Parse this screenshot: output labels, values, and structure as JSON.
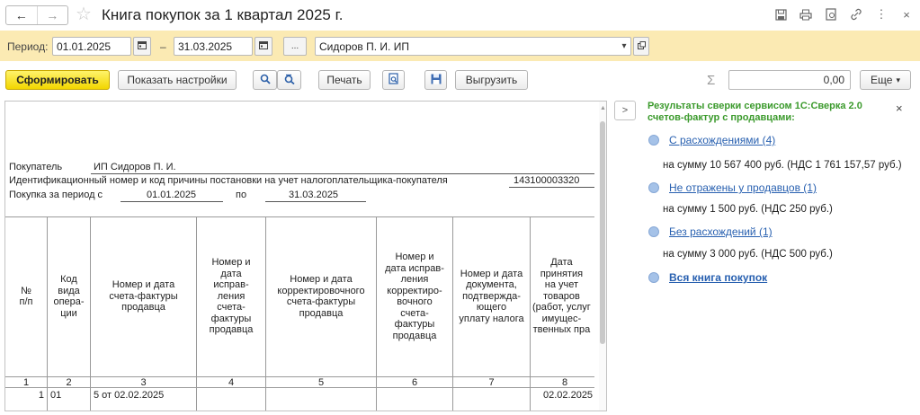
{
  "window": {
    "title": "Книга покупок за 1 квартал 2025 г.",
    "back_icon": "arrow-left",
    "forward_icon": "arrow-right",
    "favorite_icon": "star",
    "more_icon": "⋮",
    "close_icon": "×"
  },
  "period": {
    "label": "Период:",
    "from": "01.01.2025",
    "dash": "–",
    "to": "31.03.2025",
    "ellipsis": "...",
    "organization": "Сидоров П. И. ИП"
  },
  "toolbar": {
    "generate": "Сформировать",
    "show_settings": "Показать настройки",
    "print": "Печать",
    "export": "Выгрузить",
    "sigma": "Σ",
    "sum_value": "0,00",
    "more": "Еще"
  },
  "report": {
    "buyer_label": "Покупатель",
    "buyer_value": "ИП Сидоров П. И.",
    "inn_label": "Идентификационный номер и код причины постановки на учет налогоплательщика-покупателя",
    "inn_value": "143100003320",
    "period_label": "Покупка за период с",
    "period_from": "01.01.2025",
    "period_to_label": "по",
    "period_to": "31.03.2025",
    "columns": [
      {
        "num": "1",
        "header": "№\nп/п"
      },
      {
        "num": "2",
        "header": "Код\nвида\nопера-\nции"
      },
      {
        "num": "3",
        "header": "Номер и дата\nсчета-фактуры\nпродавца"
      },
      {
        "num": "4",
        "header": "Номер и\nдата\nисправ-\nления\nсчета-\nфактуры\nпродавца"
      },
      {
        "num": "5",
        "header": "Номер и дата\nкорректировочного\nсчета-фактуры\nпродавца"
      },
      {
        "num": "6",
        "header": "Номер и\nдата исправ-\nления\nкорректиро-\nвочного\nсчета-\nфактуры\nпродавца"
      },
      {
        "num": "7",
        "header": "Номер и дата\nдокумента,\nподтвержда-\nющего\nуплату налога"
      },
      {
        "num": "8",
        "header": "Дата\nпринятия\nна учет\nтоваров\n(работ, услуг\nимущес-\nтвенных пра"
      }
    ],
    "row1": {
      "n": "1",
      "code": "01",
      "invoice": "5 от 02.02.2025",
      "accept_date": "02.02.2025"
    }
  },
  "side": {
    "title": "Результаты сверки сервисом 1С:Сверка 2.0 счетов-фактур с продавцами:",
    "items": [
      {
        "link": "С расхождениями (4)",
        "sum": "на сумму 10 567 400 руб. (НДС 1 761 157,57 руб.)"
      },
      {
        "link": "Не отражены у продавцов (1)",
        "sum": "на сумму 1 500 руб. (НДС 250 руб.)"
      },
      {
        "link": "Без расхождений (1)",
        "sum": "на сумму 3 000 руб. (НДС 500 руб.)"
      },
      {
        "link": "Вся книга покупок",
        "sum": ""
      }
    ]
  }
}
